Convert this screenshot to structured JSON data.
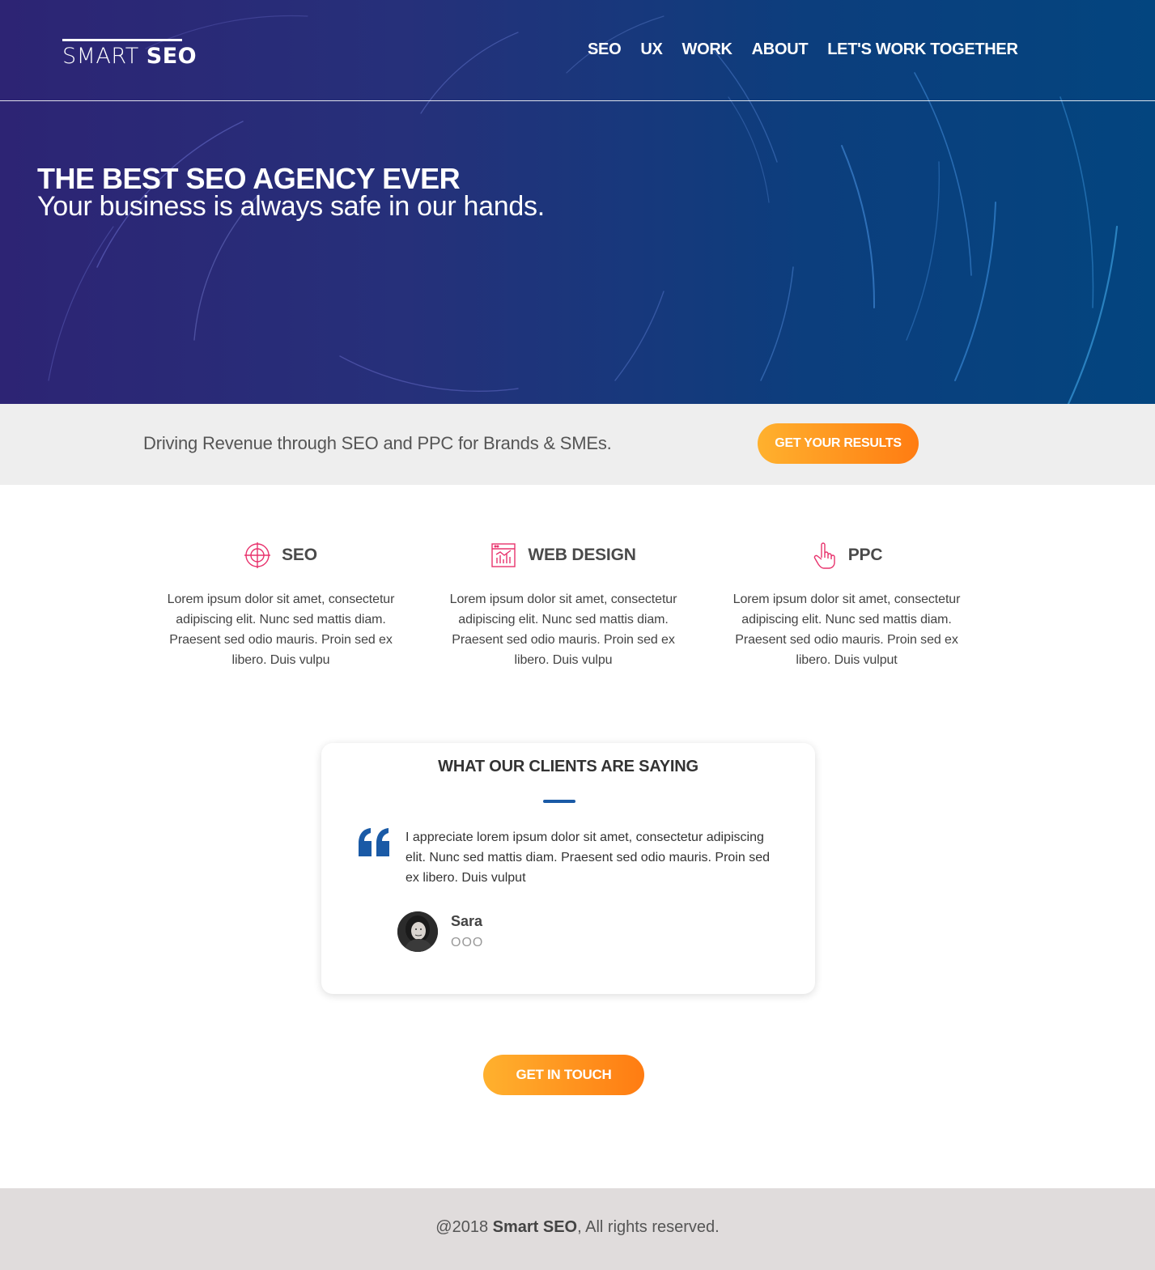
{
  "header": {
    "logo_light": "SMART",
    "logo_bold": "SEO",
    "nav": [
      "SEO",
      "UX",
      "WORK",
      "ABOUT",
      "LET'S WORK TOGETHER"
    ]
  },
  "hero": {
    "title": "THE BEST SEO AGENCY EVER",
    "subtitle": "Your business is always safe in our hands."
  },
  "cta_strip": {
    "text": "Driving Revenue through SEO and PPC for Brands & SMEs.",
    "button": "GET YOUR RESULTS"
  },
  "services": [
    {
      "icon": "target-icon",
      "title": "SEO",
      "text": "Lorem ipsum dolor sit amet, consectetur adipiscing elit. Nunc sed mattis diam. Praesent sed odio mauris. Proin sed ex libero. Duis vulpu"
    },
    {
      "icon": "chart-browser-icon",
      "title": "WEB DESIGN",
      "text": "Lorem ipsum dolor sit amet, consectetur adipiscing elit. Nunc sed mattis diam. Praesent sed odio mauris. Proin sed ex libero. Duis vulpu"
    },
    {
      "icon": "pointer-hand-icon",
      "title": "PPC",
      "text": "Lorem ipsum dolor sit amet, consectetur adipiscing elit. Nunc sed mattis diam. Praesent sed odio mauris. Proin sed ex libero. Duis vulput"
    }
  ],
  "testimonial": {
    "title_pre": "WHAT ",
    "title_bold": "OUR CLIENTS",
    "title_post": " ARE SAYING",
    "quote": "I appreciate lorem ipsum dolor sit amet, consectetur adipiscing elit. Nunc sed mattis diam. Praesent sed odio mauris. Proin sed ex libero. Duis vulput",
    "author": "Sara",
    "author_role": "OOO"
  },
  "contact_button": "GET IN TOUCH",
  "footer": {
    "prefix": "@2018 ",
    "brand": "Smart SEO",
    "suffix": ", All rights reserved."
  },
  "colors": {
    "accent_orange_start": "#ffb12e",
    "accent_orange_end": "#ff7c12",
    "icon_pink": "#e8336d",
    "quote_blue": "#1a5aa6"
  }
}
